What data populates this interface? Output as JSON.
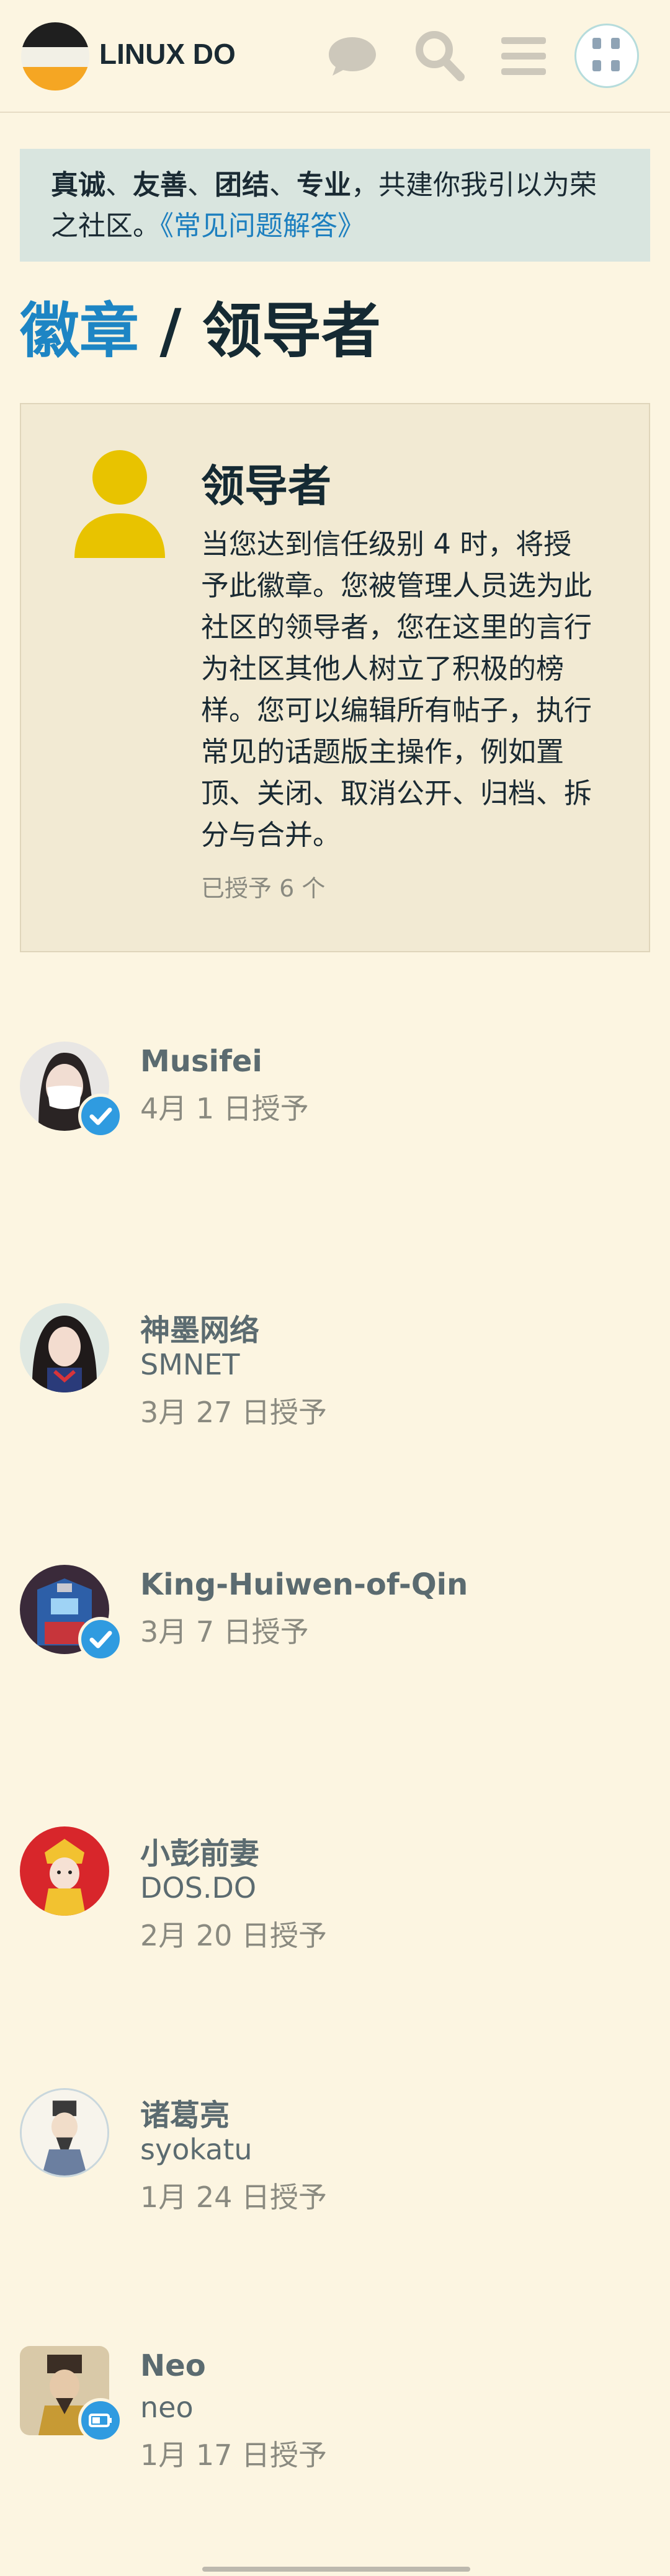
{
  "header": {
    "site_name": "LINUX DO",
    "icons": [
      "chat-icon",
      "search-icon",
      "hamburger-menu-icon",
      "user-avatar"
    ]
  },
  "banner": {
    "w1": "真诚",
    "s1": "、",
    "w2": "友善",
    "s2": "、",
    "w3": "团结",
    "s3": "、",
    "w4": "专业",
    "rest": "，共建你我引以为荣之社区。",
    "link": "《常见问题解答》"
  },
  "breadcrumb": {
    "parent": "徽章",
    "separator": " / ",
    "current": "领导者"
  },
  "badge": {
    "title": "领导者",
    "description": "当您达到信任级别 4 时，将授予此徽章。您被管理人员选为此社区的领导者，您在这里的言行为社区其他人树立了积极的榜样。您可以编辑所有帖子，执行常见的话题版主操作，例如置顶、关闭、取消公开、归档、拆分与合并。",
    "granted_count": "已授予 6 个",
    "color": "#e8c300"
  },
  "users": [
    {
      "name": "Musifei",
      "line2": "4月 1 日授予",
      "line3": ""
    },
    {
      "name": "神墨网络",
      "line2": "SMNET",
      "line3": "3月 27 日授予"
    },
    {
      "name": "King-Huiwen-of-Qin",
      "line2": "3月 7 日授予",
      "line3": ""
    },
    {
      "name": "小彭前妻",
      "line2": "DOS.DO",
      "line3": "2月 20 日授予"
    },
    {
      "name": "诸葛亮",
      "line2": "syokatu",
      "line3": "1月 24 日授予"
    },
    {
      "name": "Neo",
      "line2": "neo",
      "line3": "1月 17 日授予"
    }
  ],
  "colors": {
    "background": "#fcf5e1",
    "link": "#1d85c4",
    "banner": "#d9e5df",
    "card": "#f2ead3",
    "flair": "#2f9be0"
  }
}
